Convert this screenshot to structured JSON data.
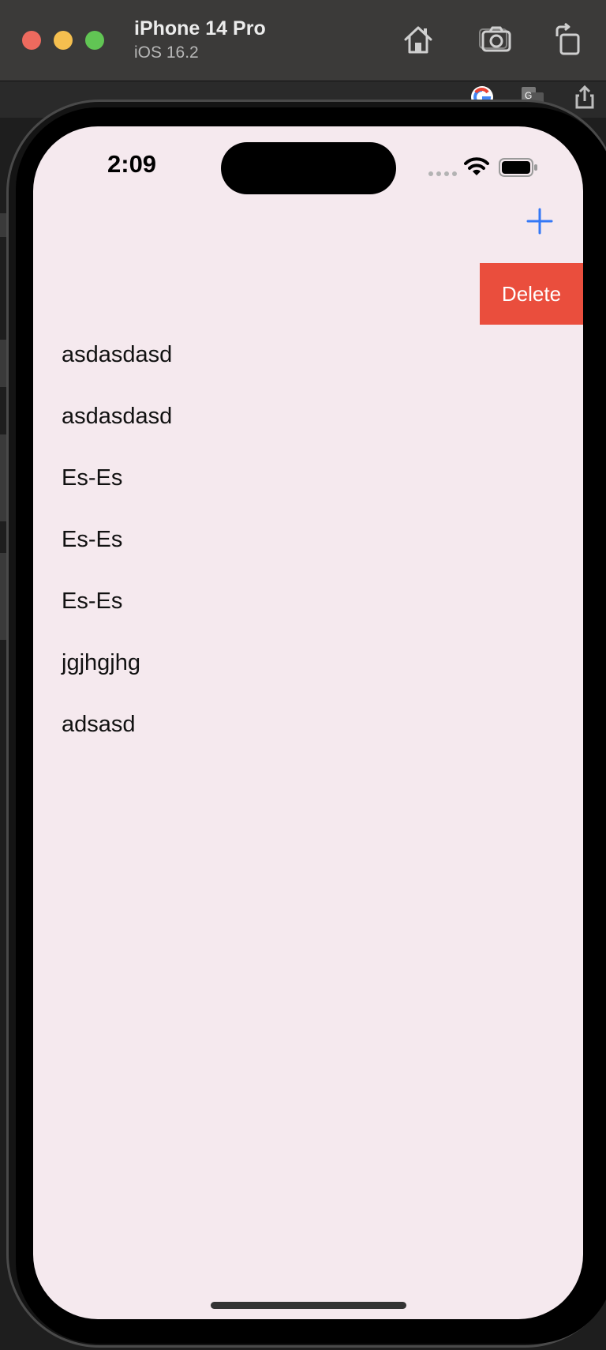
{
  "titlebar": {
    "device_name": "iPhone 14 Pro",
    "os_version": "iOS 16.2",
    "icons": [
      "home-icon",
      "screenshot-icon",
      "rotate-icon"
    ]
  },
  "host_toolbar": {
    "icons": [
      "google-icon",
      "translate-icon",
      "share-icon"
    ]
  },
  "status_bar": {
    "time": "2:09",
    "icons": [
      "cellular-signal-icon",
      "wifi-icon",
      "battery-icon"
    ]
  },
  "nav": {
    "add_icon": "plus-icon",
    "accent_color": "#3478f6"
  },
  "swipe_action": {
    "delete_label": "Delete",
    "color": "#ea4e3d"
  },
  "list": {
    "items": [
      {
        "label": "asdasdasd"
      },
      {
        "label": "asdasdasd"
      },
      {
        "label": "Es-Es"
      },
      {
        "label": "Es-Es"
      },
      {
        "label": "Es-Es"
      },
      {
        "label": "jgjhgjhg"
      },
      {
        "label": "adsasd"
      }
    ]
  }
}
